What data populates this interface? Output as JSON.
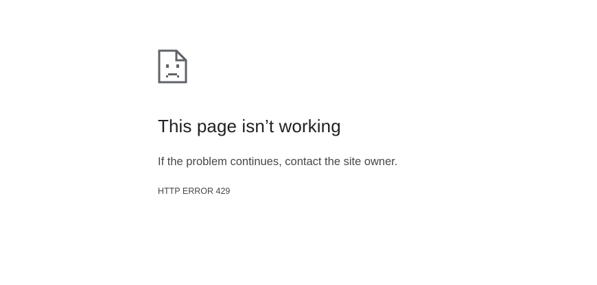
{
  "error_page": {
    "icon": "sad-document-icon",
    "headline": "This page isn’t working",
    "message": "If the problem continues, contact the site owner.",
    "error_code": "HTTP ERROR 429"
  },
  "colors": {
    "icon": "#5f6368",
    "headline": "#202124",
    "text": "#474747",
    "background": "#ffffff"
  }
}
